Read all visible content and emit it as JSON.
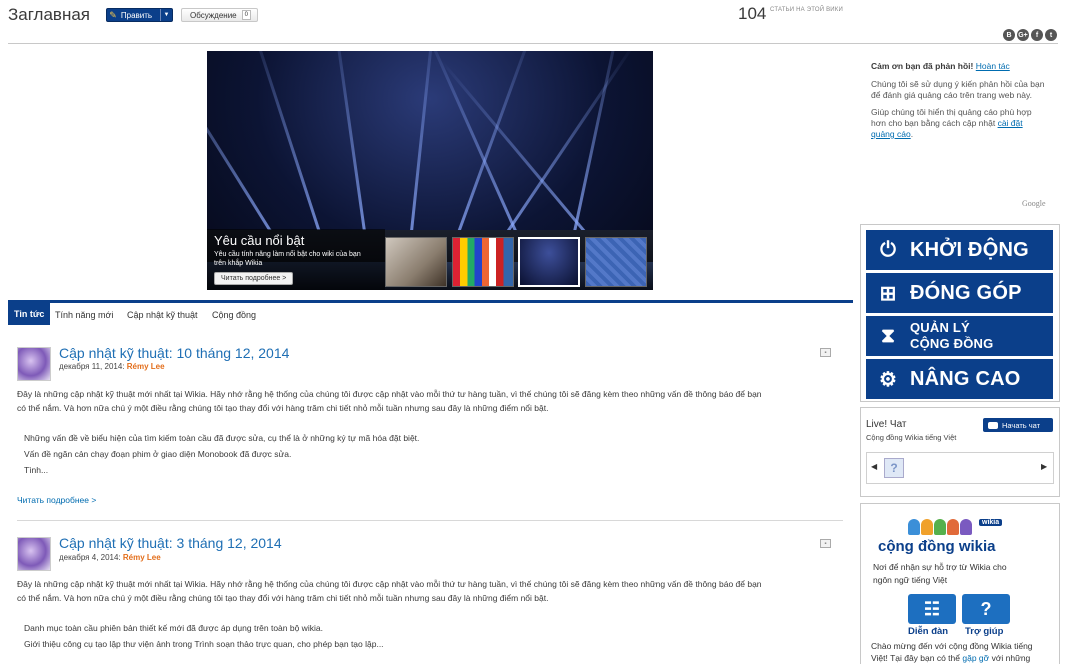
{
  "header": {
    "title": "Заглавная",
    "edit_label": "Править",
    "talk_label": "Обсуждение",
    "talk_count": "0",
    "article_count": "104",
    "article_count_label": "СТАТЬИ НА ЭТОЙ ВИКИ",
    "share_icons": [
      "B",
      "G+",
      "f",
      "t"
    ]
  },
  "hero": {
    "title": "Yêu cầu nổi bật",
    "subtitle": "Yêu cầu tính năng làm nổi bật cho wiki của bạn trên khắp Wikia",
    "readmore": "Читать подробнее >"
  },
  "tabs": [
    {
      "label": "Tin tức",
      "active": true
    },
    {
      "label": "Tính năng mới",
      "active": false
    },
    {
      "label": "Cập nhật kỹ thuật",
      "active": false
    },
    {
      "label": "Cộng đồng",
      "active": false
    }
  ],
  "posts": [
    {
      "title": "Cập nhật kỹ thuật: 10 tháng 12, 2014",
      "date": "декабря 11, 2014:",
      "author": "Rémy Lee",
      "body1": "Đây là những cập nhật kỹ thuật mới nhất tại Wikia. Hãy nhớ rằng hệ thống của chúng tôi được cập nhật vào mỗi thứ tư hàng tuần, vì thế chúng tôi sẽ đăng kèm theo những vấn đề thông báo để bạn",
      "body2": "có thể nắm. Và hơn nữa chú ý một điều rằng chúng tôi tạo thay đổi với hàng trăm chi tiết nhỏ mỗi tuần nhưng sau đây là những điểm nổi bật.",
      "items": [
        "Những vấn đề về biểu hiện của tìm kiếm toàn cầu đã được sửa, cụ thể là ở những ký tự mã hóa đặt biệt.",
        "Vấn đề ngăn cản chạy đoạn phim ở giao diện Monobook đã được sửa.",
        "Tình..."
      ],
      "readmore": "Читать подробнее >"
    },
    {
      "title": "Cập nhật kỹ thuật: 3 tháng 12, 2014",
      "date": "декабря 4, 2014:",
      "author": "Rémy Lee",
      "body1": "Đây là những cập nhật kỹ thuật mới nhất tại Wikia. Hãy nhớ rằng hệ thống của chúng tôi được cập nhật vào mỗi thứ tư hàng tuần, vì thế chúng tôi sẽ đăng kèm theo những vấn đề thông báo để bạn",
      "body2": "có thể nắm. Và hơn nữa chú ý một điều rằng chúng tôi tạo thay đổi với hàng trăm chi tiết nhỏ mỗi tuần nhưng sau đây là những điểm nổi bật.",
      "items": [
        "Danh mục toàn cầu phiên bản thiết kế mới đã được áp dụng trên toàn bộ wikia.",
        "Giới thiệu công cụ tạo lập thư viện ảnh trong Trình soạn thảo trực quan, cho phép bạn tạo lập..."
      ]
    }
  ],
  "ad_feedback": {
    "thanks": "Cảm ơn bạn đã phản hồi!",
    "undo": "Hoàn tác",
    "line1": "Chúng tôi sẽ sử dụng ý kiến phản hồi của bạn",
    "line2": "để đánh giá quảng cáo trên trang web này.",
    "line3": "Giúp chúng tôi hiển thị quảng cáo phù hợp",
    "line4": "hơn cho bạn bằng cách cập nhật",
    "settings_link1": "cài đặt",
    "settings_link2": "quảng cáo",
    "google": "Google"
  },
  "actions": [
    {
      "label": "KHỞI ĐỘNG",
      "icon": "power-icon"
    },
    {
      "label": "ĐÓNG GÓP",
      "icon": "add-page-icon"
    },
    {
      "label": "QUẢN LÝ",
      "label2": "CỘNG ĐỒNG",
      "icon": "sliders-icon"
    },
    {
      "label": "NÂNG CAO",
      "icon": "gears-icon"
    }
  ],
  "chat": {
    "title": "Live! Чат",
    "subtitle": "Cộng đồng Wikia tiếng Việt",
    "button": "Начать чат"
  },
  "community": {
    "badge": "wikia",
    "logo": "cộng đồng wikia",
    "desc1": "Nơi để nhận sự hỗ trợ từ Wikia cho",
    "desc2": "ngôn ngữ tiếng Việt",
    "forum": "Diễn đàn",
    "help": "Trợ giúp",
    "welcome1": "Chào mừng đến với cộng đồng Wikia tiếng",
    "welcome2": "Việt! Tại đây bạn có thể",
    "welcome_link": "gặp gỡ",
    "welcome3": "với những"
  },
  "colors": {
    "brand": "#0b3f8a",
    "link": "#006cb0",
    "author": "#e36e1b"
  }
}
